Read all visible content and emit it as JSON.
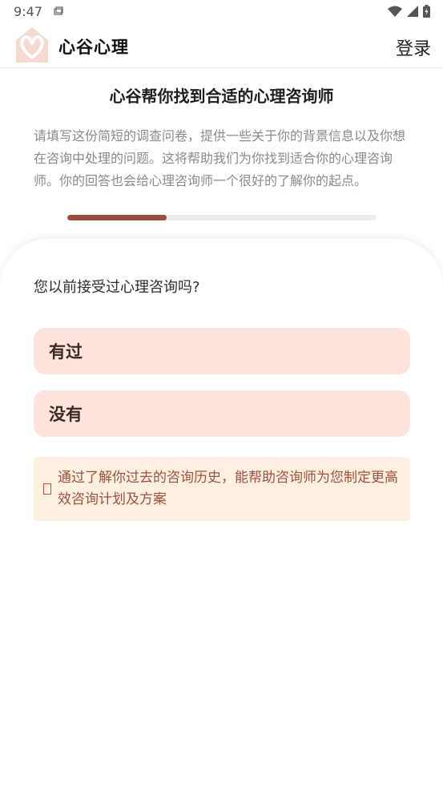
{
  "status_bar": {
    "time": "9:47",
    "icons": [
      "notification-icon",
      "wifi-icon",
      "signal-icon",
      "battery-icon"
    ]
  },
  "header": {
    "app_name": "心谷心理",
    "login_label": "登录",
    "logo_icon": "heart-house-logo"
  },
  "intro": {
    "title": "心谷帮你找到合适的心理咨询师",
    "description": "请填写这份简短的调查问卷，提供一些关于你的背景信息以及你想在咨询中处理的问题。这将帮助我们为你找到适合你的心理咨询师。你的回答也会给心理咨询师一个很好的了解你的起点。",
    "progress": 0.32
  },
  "question": {
    "text": "您以前接受过心理咨询吗?",
    "options": [
      "有过",
      "没有"
    ]
  },
  "tip": {
    "icon": "info-icon",
    "text": "通过了解你过去的咨询历史，能帮助咨询师为您制定更高效咨询计划及方案"
  },
  "colors": {
    "accent": "#9a4c3a",
    "option_bg": "#fde3dc",
    "tip_bg": "#fdf0e1",
    "tip_text": "#a0503e",
    "logo_bg": "#f7d9cf"
  }
}
